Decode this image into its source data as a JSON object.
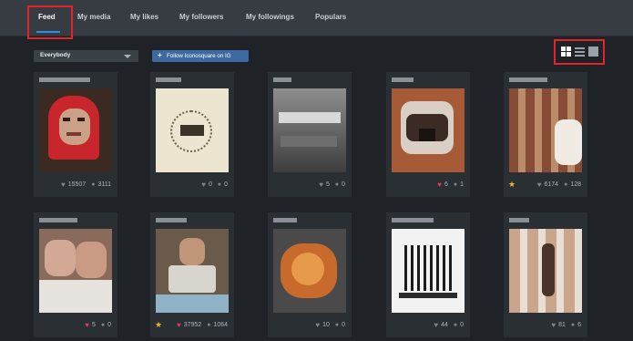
{
  "nav": {
    "tabs": [
      {
        "label": "Feed",
        "active": true
      },
      {
        "label": "My media"
      },
      {
        "label": "My likes"
      },
      {
        "label": "My followers"
      },
      {
        "label": "My followings"
      },
      {
        "label": "Populars"
      }
    ]
  },
  "toolbar": {
    "filter_value": "Everybody",
    "follow_label": "Follow Iconosquare on IG",
    "follow_icon": "plus-icon"
  },
  "view_modes": [
    "grid-icon",
    "list-icon",
    "single-icon"
  ],
  "colors": {
    "accent": "#2f8ee0",
    "highlight": "#e0242a",
    "like": "#e4395a",
    "star": "#f3b417"
  },
  "cards": [
    {
      "likes": "15507",
      "comments": "3111",
      "liked": false,
      "starred": false
    },
    {
      "likes": "0",
      "comments": "0",
      "liked": false,
      "starred": false
    },
    {
      "likes": "5",
      "comments": "0",
      "liked": false,
      "starred": false
    },
    {
      "likes": "6",
      "comments": "1",
      "liked": true,
      "starred": false
    },
    {
      "likes": "6174",
      "comments": "128",
      "liked": false,
      "starred": true
    },
    {
      "likes": "5",
      "comments": "0",
      "liked": true,
      "starred": false
    },
    {
      "likes": "37952",
      "comments": "1064",
      "liked": true,
      "starred": true
    },
    {
      "likes": "10",
      "comments": "0",
      "liked": false,
      "starred": false
    },
    {
      "likes": "44",
      "comments": "0",
      "liked": false,
      "starred": false
    },
    {
      "likes": "81",
      "comments": "6",
      "liked": false,
      "starred": false
    }
  ]
}
